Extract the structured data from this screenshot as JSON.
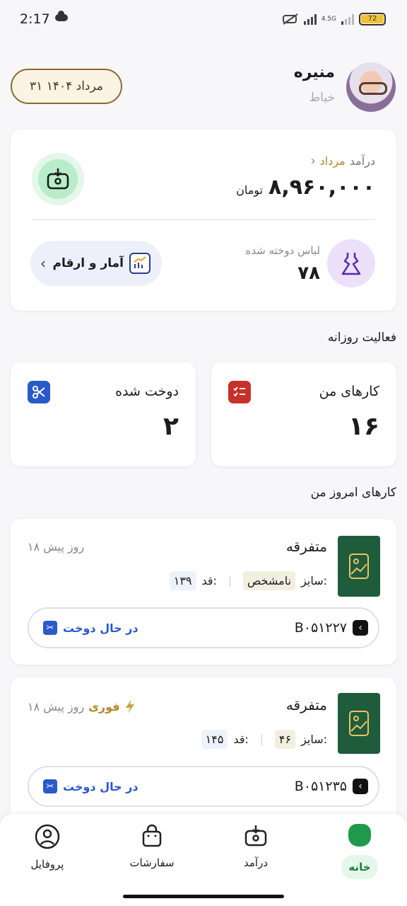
{
  "status_bar": {
    "time": "2:17",
    "network": "4.5G",
    "battery": "72"
  },
  "profile": {
    "name": "منیره",
    "role": "خیاط",
    "date": "۳۱ مرداد ۱۴۰۴"
  },
  "income": {
    "label": "درآمد",
    "month": "مرداد",
    "amount": "۸,۹۶۰,۰۰۰",
    "currency": "تومان"
  },
  "sewn_clothes": {
    "label": "لباس دوخته شده",
    "count": "۷۸"
  },
  "stats_button": {
    "label": "آمار و ارقام"
  },
  "daily_activity": {
    "title": "فعالیت روزانه",
    "cards": [
      {
        "title": "کارهای من",
        "value": "۱۶",
        "icon": "checklist-icon",
        "color": "#c8302a"
      },
      {
        "title": "دوخت شده",
        "value": "۲",
        "icon": "scissors-icon",
        "color": "#2a59c9"
      }
    ]
  },
  "today_jobs": {
    "title": "کارهای امروز من",
    "items": [
      {
        "title": "متفرقه",
        "ago": "۱۸ روز پیش",
        "urgent": "",
        "size_label": "سایز:",
        "size_value": "نامشخص",
        "height_label": "قد:",
        "height_value": "۱۳۹",
        "code": "B۰۵۱۲۲۷",
        "status": "در حال دوخت"
      },
      {
        "title": "متفرقه",
        "ago": "۱۸ روز پیش",
        "urgent": "فوری",
        "size_label": "سایز:",
        "size_value": "۴۶",
        "height_label": "قد:",
        "height_value": "۱۴۵",
        "code": "B۰۵۱۲۳۵",
        "status": "در حال دوخت"
      }
    ]
  },
  "nav": {
    "home": "خانه",
    "income": "درآمد",
    "orders": "سفارشات",
    "profile": "پروفایل"
  },
  "colors": {
    "accent_green": "#1f9a4d",
    "accent_gold": "#b0892b",
    "accent_blue": "#2a59c9"
  }
}
